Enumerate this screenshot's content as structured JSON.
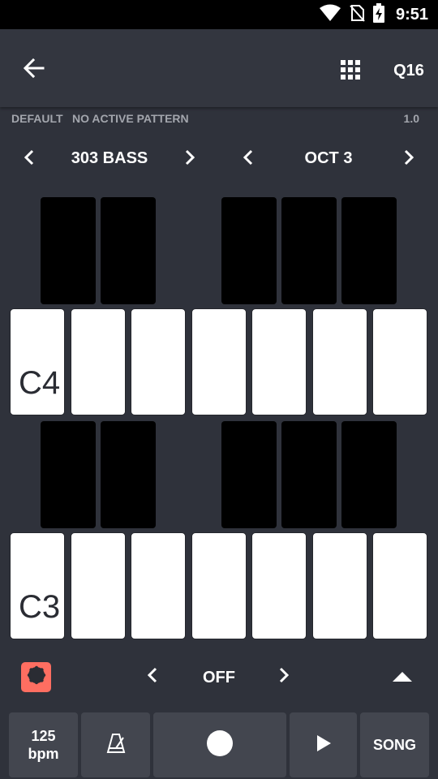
{
  "status_bar": {
    "time": "9:51",
    "icons": [
      "wifi-icon",
      "no-sim-icon",
      "battery-charging-icon"
    ]
  },
  "app_bar": {
    "back_icon": "arrow-left-icon",
    "grid_icon": "grid-icon",
    "quantize_label": "Q16"
  },
  "info_bar": {
    "kit": "DEFAULT",
    "pattern": "NO ACTIVE PATTERN",
    "version": "1.0"
  },
  "selectors": {
    "instrument": "303 BASS",
    "octave": "OCT 3"
  },
  "keyboard": {
    "upper_label": "C4",
    "lower_label": "C3",
    "white_key_color": "#ffffff",
    "black_key_color": "#000000"
  },
  "control_bar": {
    "value": "OFF",
    "accent": "#ff6e61"
  },
  "transport": {
    "tempo_value": "125",
    "tempo_unit": "bpm",
    "song_label": "SONG"
  },
  "colors": {
    "background": "#2f323b",
    "appbar": "#33363f",
    "button": "#43464f",
    "muted_text": "#a3a6ad"
  }
}
